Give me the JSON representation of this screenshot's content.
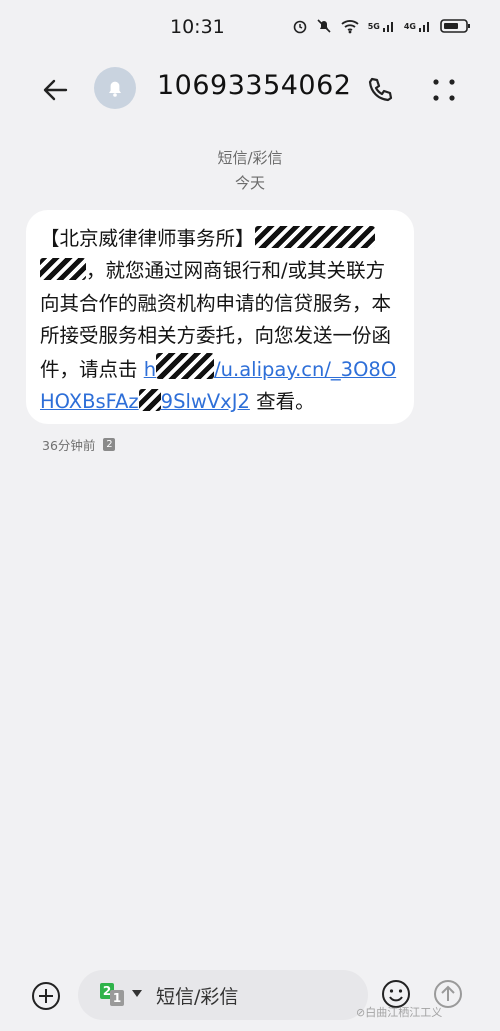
{
  "status": {
    "time": "10:31",
    "net1": "5G",
    "net2": "4G"
  },
  "header": {
    "contact_name": "10693354062"
  },
  "conversation": {
    "channel_label": "短信/彩信",
    "date_label": "今天",
    "message": {
      "sender_tag": "【北京威律律师事务所】",
      "text_part1": "，就您通过网商银行和/或其关联方向其合作的融资机构申请的信贷服务，本所接受服务相关方委托，向您发送一份函件，请点击",
      "link_start": "h",
      "link_mid": "/u.alipay.cn/_3O8OHOXBsFAz",
      "link_end": "9SlwVxJ2",
      "text_part2": "查看。",
      "time_ago": "36分钟前",
      "sim_slot": "2"
    }
  },
  "composer": {
    "placeholder": "短信/彩信",
    "sim_primary": "2",
    "sim_secondary": "1"
  },
  "watermark": "⊘白曲江栖江工义"
}
